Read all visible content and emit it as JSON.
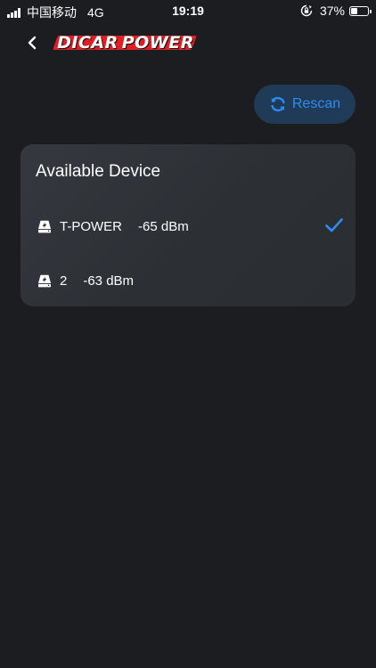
{
  "status_bar": {
    "carrier": "中国移动",
    "network": "4G",
    "time": "19:19",
    "battery_percent": "37%",
    "battery_level": 0.37
  },
  "nav": {
    "back_icon": "chevron-left-icon",
    "logo_text_a": "DICAR",
    "logo_text_b": "POWER",
    "logo_accent_color": "#e21d24"
  },
  "rescan": {
    "label": "Rescan",
    "icon": "refresh-icon",
    "color": "#2d8cf0"
  },
  "devices_card": {
    "title": "Available Device",
    "items": [
      {
        "name": "T-POWER",
        "signal": "-65 dBm",
        "selected": true,
        "icon": "device-icon"
      },
      {
        "name": "2",
        "signal": "-63 dBm",
        "selected": false,
        "icon": "device-icon"
      }
    ]
  }
}
